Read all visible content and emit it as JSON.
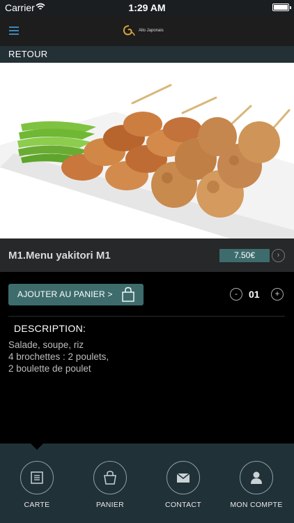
{
  "status_bar": {
    "carrier": "Carrier",
    "time": "1:29 AM"
  },
  "header": {
    "brand": "Allo Japonais",
    "menu_icon": "hamburger-icon"
  },
  "nav": {
    "back_label": "RETOUR"
  },
  "product": {
    "name": "M1.Menu yakitori M1",
    "price": "7.50€",
    "add_to_cart_label": "AJOUTER AU PANIER >",
    "quantity": "01",
    "qty_minus": "-",
    "qty_plus": "+",
    "description_title": "DESCRIPTION:",
    "description_lines": [
      "Salade, soupe, riz",
      "4 brochettes : 2 poulets,",
      "2 boulette de poulet"
    ]
  },
  "tabs": [
    {
      "label": "CARTE",
      "icon": "menu-card-icon"
    },
    {
      "label": "PANIER",
      "icon": "shopping-bag-icon"
    },
    {
      "label": "CONTACT",
      "icon": "envelope-icon"
    },
    {
      "label": "MON COMPTE",
      "icon": "user-icon"
    }
  ],
  "colors": {
    "accent": "#3e6c6d",
    "tabbar": "#213138",
    "menu_icon": "#3e88b8"
  }
}
